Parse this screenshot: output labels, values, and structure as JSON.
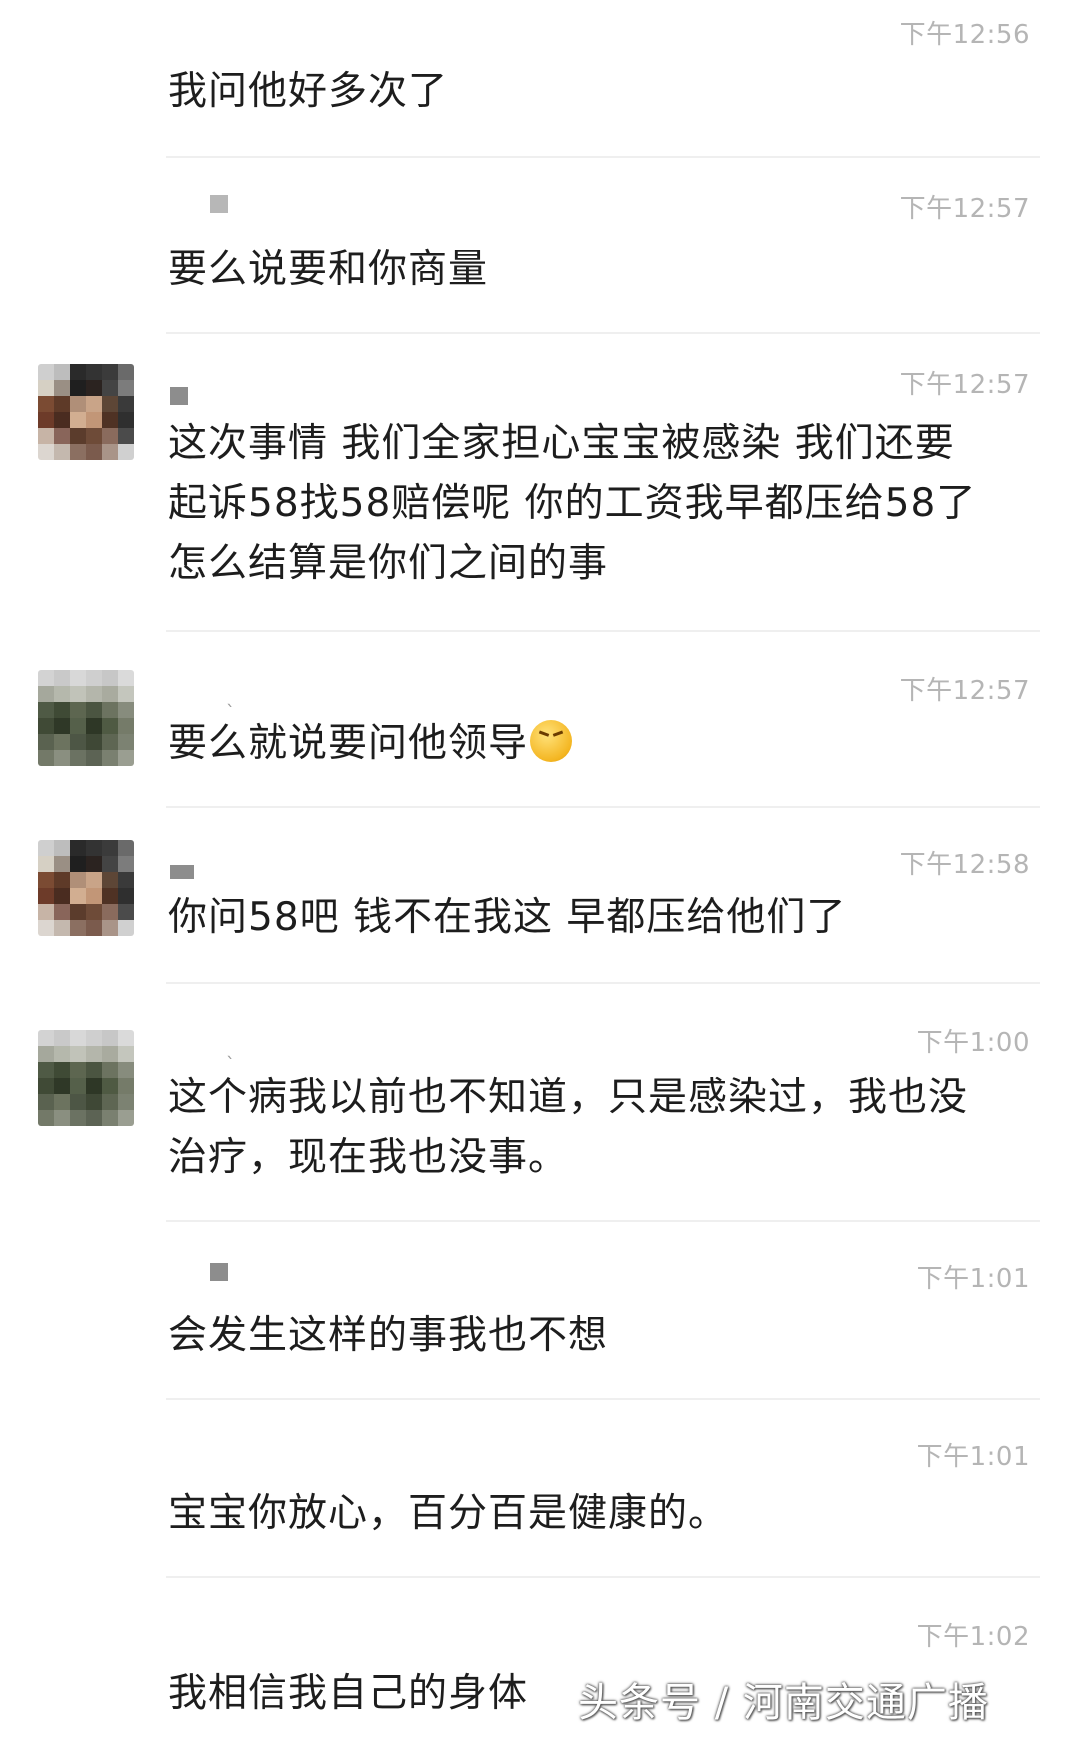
{
  "messages": [
    {
      "time": "下午12:56",
      "text": "我问他好多次了"
    },
    {
      "time": "下午12:57",
      "text": "要么说要和你商量"
    },
    {
      "time": "下午12:57",
      "text": "这次事情 我们全家担心宝宝被感染 我们还要\n起诉58找58赔偿呢 你的工资我早都压给58了\n怎么结算是你们之间的事"
    },
    {
      "time": "下午12:57",
      "text": "要么就说要问他领导"
    },
    {
      "time": "下午12:58",
      "text": "你问58吧 钱不在我这 早都压给他们了"
    },
    {
      "time": "下午1:00",
      "text": "这个病我以前也不知道，只是感染过，我也没\n治疗，现在我也没事。"
    },
    {
      "time": "下午1:01",
      "text": "会发生这样的事我也不想"
    },
    {
      "time": "下午1:01",
      "text": "宝宝你放心，百分百是健康的。"
    },
    {
      "time": "下午1:02",
      "text": "我相信我自己的身体"
    }
  ],
  "emoji": "crying-face-emoji",
  "watermark": "头条号 / 河南交通广播",
  "colors": {
    "text": "#1d1d1d",
    "time": "#b5b5b5",
    "divider": "#efefef"
  }
}
